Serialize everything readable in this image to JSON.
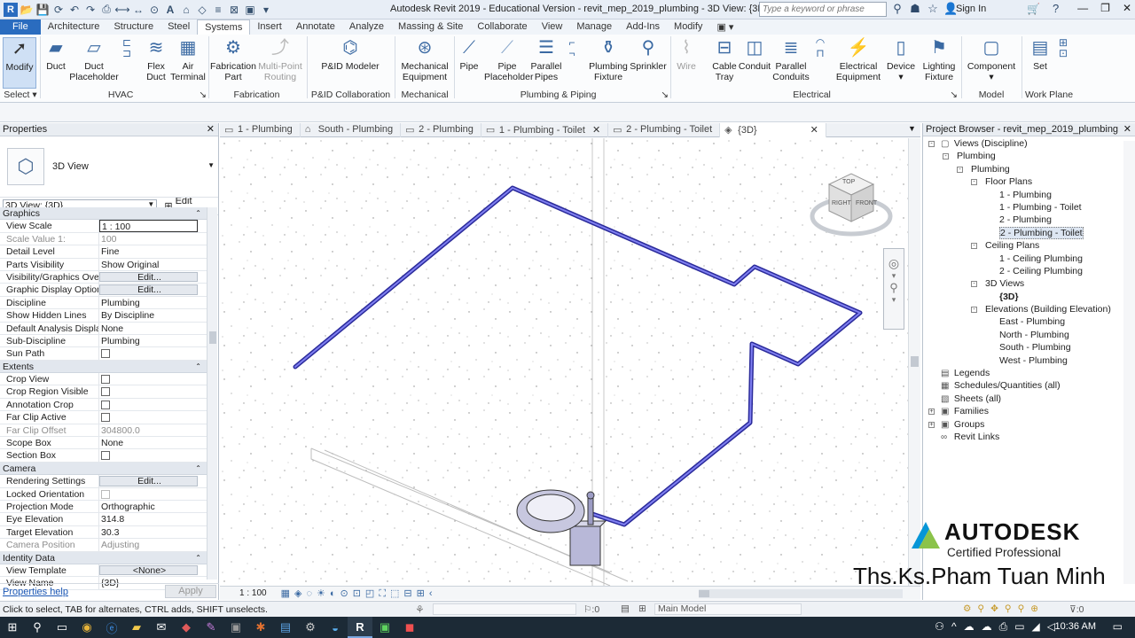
{
  "window": {
    "title": "Autodesk Revit 2019 - Educational Version - revit_mep_2019_plumbing - 3D View: {3D}",
    "search_placeholder": "Type a keyword or phrase",
    "sign_in": "Sign In"
  },
  "ribbon_tabs": [
    "File",
    "Architecture",
    "Structure",
    "Steel",
    "Systems",
    "Insert",
    "Annotate",
    "Analyze",
    "Massing & Site",
    "Collaborate",
    "View",
    "Manage",
    "Add-Ins",
    "Modify"
  ],
  "active_tab": "Systems",
  "ribbon": {
    "modify": "Modify",
    "select": "Select",
    "duct": "Duct",
    "duct_placeholder": "Duct Placeholder",
    "flex_duct": "Flex Duct",
    "air_terminal": "Air Terminal",
    "fabrication_part": "Fabrication Part",
    "multi_point_routing": "Multi-Point Routing",
    "pid_modeler": "P&ID Modeler",
    "mechanical_equipment": "Mechanical Equipment",
    "pipe": "Pipe",
    "pipe_placeholder": "Pipe Placeholder",
    "parallel_pipes": "Parallel Pipes",
    "plumbing_fixture": "Plumbing Fixture",
    "sprinkler": "Sprinkler",
    "wire": "Wire",
    "cable_tray": "Cable Tray",
    "conduit": "Conduit",
    "parallel_conduits": "Parallel Conduits",
    "electrical_equipment": "Electrical Equipment",
    "device": "Device",
    "lighting_fixture": "Lighting Fixture",
    "component": "Component",
    "set": "Set",
    "panels": {
      "hvac": "HVAC",
      "fabrication": "Fabrication",
      "pid": "P&ID Collaboration",
      "mechanical": "Mechanical",
      "plumbing": "Plumbing & Piping",
      "electrical": "Electrical",
      "model": "Model",
      "work_plane": "Work Plane"
    }
  },
  "properties": {
    "title": "Properties",
    "type_name": "3D View",
    "view_selector": "3D View: {3D}",
    "edit_type": "Edit Type",
    "groups": [
      {
        "name": "Graphics",
        "rows": [
          {
            "k": "View Scale",
            "v": "1 : 100",
            "kind": "inp"
          },
          {
            "k": "Scale Value    1:",
            "v": "100",
            "kind": "ro"
          },
          {
            "k": "Detail Level",
            "v": "Fine"
          },
          {
            "k": "Parts Visibility",
            "v": "Show Original"
          },
          {
            "k": "Visibility/Graphics Ove...",
            "v": "Edit...",
            "kind": "btn"
          },
          {
            "k": "Graphic Display Options",
            "v": "Edit...",
            "kind": "btn"
          },
          {
            "k": "Discipline",
            "v": "Plumbing"
          },
          {
            "k": "Show Hidden Lines",
            "v": "By Discipline"
          },
          {
            "k": "Default Analysis Displa...",
            "v": "None"
          },
          {
            "k": "Sub-Discipline",
            "v": "Plumbing"
          },
          {
            "k": "Sun Path",
            "v": "",
            "kind": "chk"
          }
        ]
      },
      {
        "name": "Extents",
        "rows": [
          {
            "k": "Crop View",
            "v": "",
            "kind": "chk"
          },
          {
            "k": "Crop Region Visible",
            "v": "",
            "kind": "chk"
          },
          {
            "k": "Annotation Crop",
            "v": "",
            "kind": "chk"
          },
          {
            "k": "Far Clip Active",
            "v": "",
            "kind": "chk"
          },
          {
            "k": "Far Clip Offset",
            "v": "304800.0",
            "kind": "ro"
          },
          {
            "k": "Scope Box",
            "v": "None"
          },
          {
            "k": "Section Box",
            "v": "",
            "kind": "chk"
          }
        ]
      },
      {
        "name": "Camera",
        "rows": [
          {
            "k": "Rendering Settings",
            "v": "Edit...",
            "kind": "btn"
          },
          {
            "k": "Locked Orientation",
            "v": "",
            "kind": "rochk"
          },
          {
            "k": "Projection Mode",
            "v": "Orthographic"
          },
          {
            "k": "Eye Elevation",
            "v": "314.8"
          },
          {
            "k": "Target Elevation",
            "v": "30.3"
          },
          {
            "k": "Camera Position",
            "v": "Adjusting",
            "kind": "ro"
          }
        ]
      },
      {
        "name": "Identity Data",
        "rows": [
          {
            "k": "View Template",
            "v": "<None>",
            "kind": "btn"
          },
          {
            "k": "View Name",
            "v": "{3D}"
          }
        ]
      }
    ],
    "help": "Properties help",
    "apply": "Apply"
  },
  "view_tabs": [
    {
      "label": "1 - Plumbing",
      "icon": "▭"
    },
    {
      "label": "South - Plumbing",
      "icon": "⌂"
    },
    {
      "label": "2 - Plumbing",
      "icon": "▭"
    },
    {
      "label": "1 - Plumbing - Toilet",
      "icon": "▭",
      "close": true
    },
    {
      "label": "2 - Plumbing - Toilet",
      "icon": "▭"
    },
    {
      "label": "{3D}",
      "icon": "◈",
      "close": true,
      "active": true
    }
  ],
  "viewcube": {
    "top": "TOP",
    "right": "RIGHT",
    "front": "FRONT"
  },
  "view_control_bar": {
    "scale": "1 : 100"
  },
  "browser": {
    "title": "Project Browser - revit_mep_2019_plumbing",
    "nodes": [
      {
        "label": "Views (Discipline)",
        "level": 0,
        "toggle": "-",
        "icon": "▢"
      },
      {
        "label": "Plumbing",
        "level": 1,
        "toggle": "-"
      },
      {
        "label": "Plumbing",
        "level": 2,
        "toggle": "-"
      },
      {
        "label": "Floor Plans",
        "level": 3,
        "toggle": "-"
      },
      {
        "label": "1 - Plumbing",
        "level": 4
      },
      {
        "label": "1 - Plumbing - Toilet",
        "level": 4
      },
      {
        "label": "2 - Plumbing",
        "level": 4
      },
      {
        "label": "2 - Plumbing - Toilet",
        "level": 4,
        "selected": true
      },
      {
        "label": "Ceiling Plans",
        "level": 3,
        "toggle": "-"
      },
      {
        "label": "1 - Ceiling Plumbing",
        "level": 4
      },
      {
        "label": "2 - Ceiling Plumbing",
        "level": 4
      },
      {
        "label": "3D Views",
        "level": 3,
        "toggle": "-"
      },
      {
        "label": "{3D}",
        "level": 4,
        "bold": true
      },
      {
        "label": "Elevations (Building Elevation)",
        "level": 3,
        "toggle": "-"
      },
      {
        "label": "East - Plumbing",
        "level": 4
      },
      {
        "label": "North - Plumbing",
        "level": 4
      },
      {
        "label": "South - Plumbing",
        "level": 4
      },
      {
        "label": "West - Plumbing",
        "level": 4
      },
      {
        "label": "Legends",
        "level": 0,
        "icon": "▤"
      },
      {
        "label": "Schedules/Quantities (all)",
        "level": 0,
        "icon": "▦"
      },
      {
        "label": "Sheets (all)",
        "level": 0,
        "icon": "▧"
      },
      {
        "label": "Families",
        "level": 0,
        "toggle": "+",
        "icon": "▣"
      },
      {
        "label": "Groups",
        "level": 0,
        "toggle": "+",
        "icon": "▣"
      },
      {
        "label": "Revit Links",
        "level": 0,
        "icon": "∞"
      }
    ]
  },
  "status": {
    "hint": "Click to select, TAB for alternates, CTRL adds, SHIFT unselects.",
    "counter": ":0",
    "model": "Main Model",
    "filter": ":0"
  },
  "watermark": {
    "brand": "AUTODESK",
    "sub": "Certified Professional",
    "name": "Ths.Ks.Pham Tuan Minh"
  },
  "taskbar": {
    "time": "10:36 AM"
  },
  "colors": {
    "pipe": "#3e3ec8",
    "file_tab": "#2a6cbf",
    "accent": "#3b6aa3"
  }
}
